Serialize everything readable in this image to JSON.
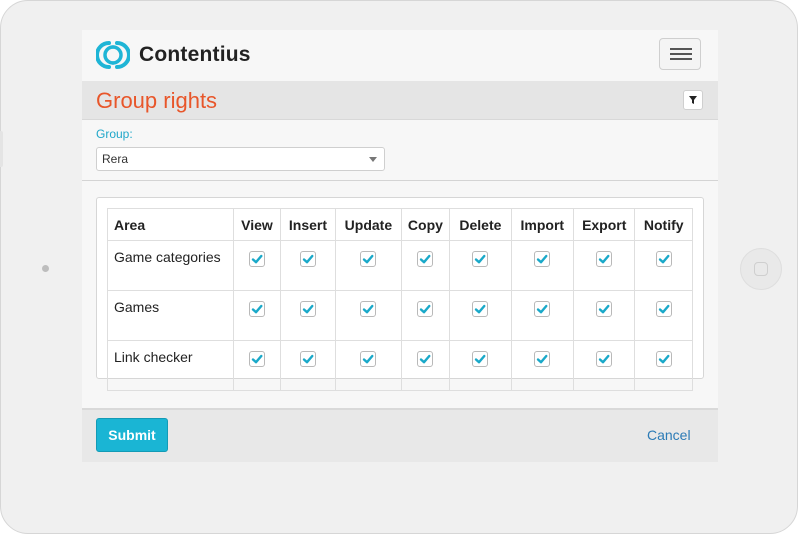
{
  "app": {
    "brand": "Contentius"
  },
  "page": {
    "title": "Group rights"
  },
  "group": {
    "label": "Group:",
    "value": "Rera"
  },
  "table": {
    "area_header": "Area",
    "permissions": [
      "View",
      "Insert",
      "Update",
      "Copy",
      "Delete",
      "Import",
      "Export",
      "Notify"
    ],
    "rows": [
      {
        "area": "Game categories",
        "checked": [
          true,
          true,
          true,
          true,
          true,
          true,
          true,
          true
        ]
      },
      {
        "area": "Games",
        "checked": [
          true,
          true,
          true,
          true,
          true,
          true,
          true,
          true
        ]
      },
      {
        "area": "Link checker",
        "checked": [
          true,
          true,
          true,
          true,
          true,
          true,
          true,
          true
        ]
      }
    ]
  },
  "footer": {
    "submit_label": "Submit",
    "cancel_label": "Cancel"
  },
  "icons": {
    "logo": "contentius-logo-icon",
    "menu": "hamburger-menu-icon",
    "filter": "filter-funnel-icon",
    "dropdown": "chevron-down-icon",
    "check": "checkmark-icon"
  },
  "colors": {
    "accent": "#1ab5d4",
    "title": "#e8562a",
    "check": "#1aa9c9",
    "link": "#2c7bb6"
  }
}
